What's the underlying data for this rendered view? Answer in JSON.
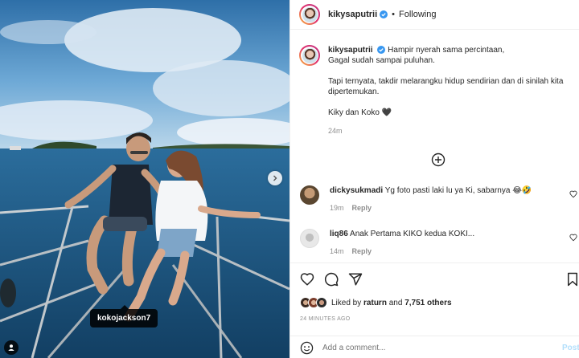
{
  "post": {
    "username": "kikysaputrii",
    "following_label": "Following",
    "separator": "•",
    "photo_tag": "kokojackson7"
  },
  "caption": {
    "username": "kikysaputrii",
    "line1": "Hampir nyerah sama percintaan,",
    "line2": "Gagal sudah sampai puluhan.",
    "para2": "Tapi ternyata, takdir melarangku hidup sendirian dan di sinilah kita dipertemukan.",
    "para3": "Kiky dan Koko",
    "para3_emoji": "🖤",
    "time": "24m"
  },
  "comments": [
    {
      "username": "dickysukmadi",
      "text": "Yg foto pasti laki lu ya Ki, sabarnya",
      "emoji": "😂🤣",
      "time": "19m",
      "reply": "Reply"
    },
    {
      "username": "liq86",
      "text": "Anak Pertama KIKO kedua KOKI...",
      "emoji": "",
      "time": "14m",
      "reply": "Reply"
    }
  ],
  "likes": {
    "prefix": "Liked by",
    "user": "raturn",
    "middle": "and",
    "count": "7,751 others"
  },
  "time_ago": "24 MINUTES AGO",
  "add_comment": {
    "placeholder": "Add a comment...",
    "post_label": "Post"
  },
  "colors": {
    "verified": "#3897f0",
    "post_disabled": "#b2dffc",
    "muted": "#8e8e8e"
  }
}
